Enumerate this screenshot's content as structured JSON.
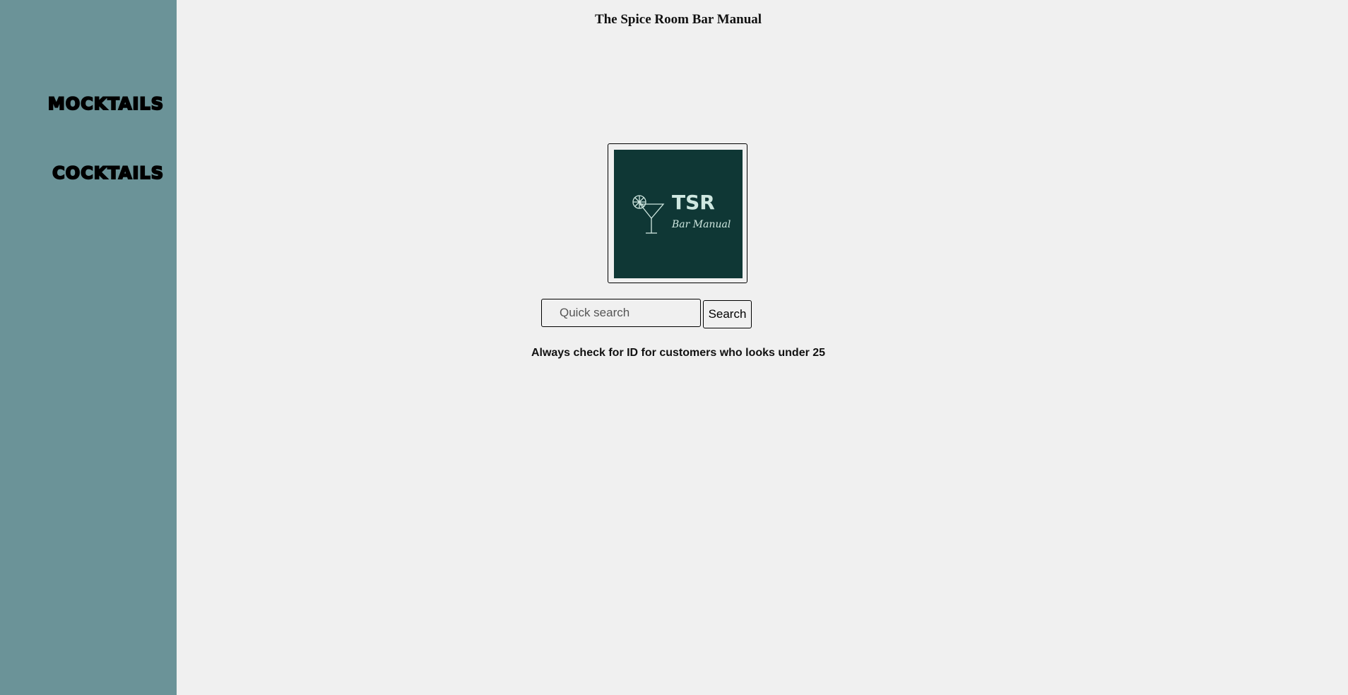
{
  "sidebar": {
    "items": [
      {
        "label": "mocktails"
      },
      {
        "label": "cocktails"
      }
    ]
  },
  "header": {
    "title": "The Spice Room Bar Manual"
  },
  "logo": {
    "icon": "cocktail-glass-icon",
    "wordmark": "TSR",
    "tagline": "Bar Manual",
    "background_color": "#0f3735",
    "accent_color": "#cfe7e0"
  },
  "search": {
    "placeholder": "Quick search",
    "value": "",
    "button_label": "Search"
  },
  "notice": {
    "text": "Always check for ID for customers who looks under 25"
  },
  "colors": {
    "sidebar_bg": "#6b9398",
    "page_bg": "#f0f0f0"
  }
}
